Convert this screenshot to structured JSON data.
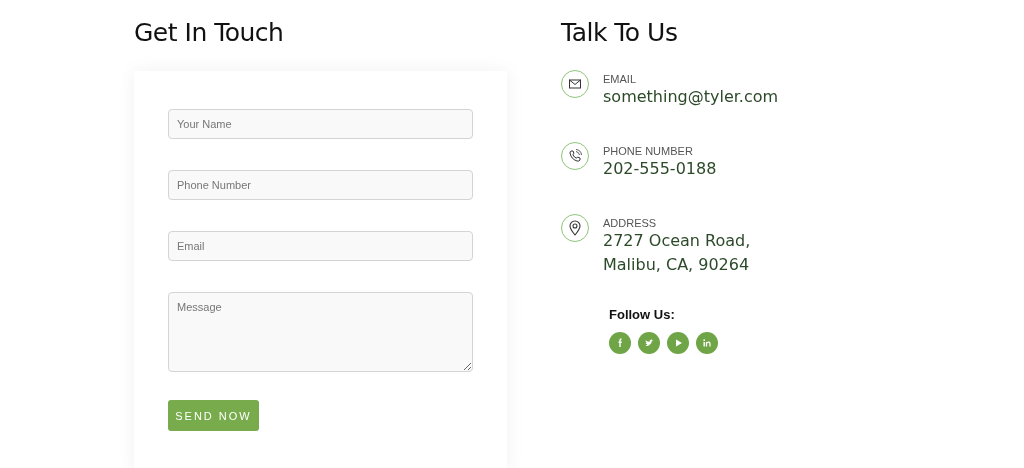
{
  "form": {
    "title": "Get In Touch",
    "fields": [
      {
        "kind": "line",
        "placeholder": "Your Name"
      },
      {
        "kind": "line",
        "placeholder": "Phone Number"
      },
      {
        "kind": "line",
        "placeholder": "Email"
      },
      {
        "kind": "area",
        "placeholder": "Message"
      }
    ],
    "button": "SEND NOW"
  },
  "contact": {
    "title": "Talk To Us",
    "items": [
      {
        "kind": "email",
        "label": "EMAIL",
        "value": "something@tyler.com"
      },
      {
        "kind": "phone",
        "label": "PHONE NUMBER",
        "value": "202-555-0188"
      },
      {
        "kind": "address",
        "label": "ADDRESS",
        "value": "2727 Ocean Road, Malibu, CA, 90264"
      }
    ],
    "follow": "Follow Us:",
    "socials": [
      {
        "kind": "facebook"
      },
      {
        "kind": "twitter"
      },
      {
        "kind": "youtube"
      },
      {
        "kind": "linkedin"
      }
    ]
  }
}
